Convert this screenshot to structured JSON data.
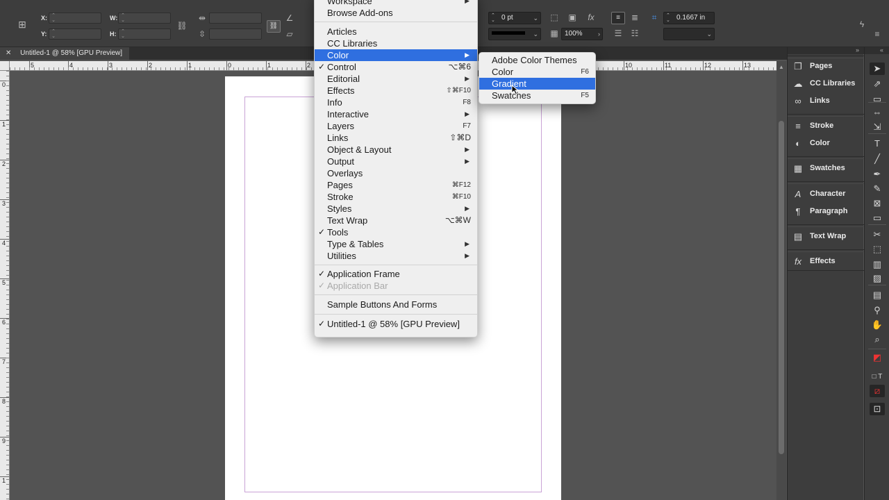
{
  "control_bar": {
    "x_label": "X:",
    "y_label": "Y:",
    "w_label": "W:",
    "h_label": "H:",
    "stroke_weight_value": "0 pt",
    "opacity_value": "100%",
    "offset_value": "0.1667 in"
  },
  "document_tab": {
    "close_glyph": "✕",
    "title": "Untitled-1 @ 58% [GPU Preview]"
  },
  "rulers": {
    "horizontal_labels": [
      "5",
      "4",
      "3",
      "2",
      "1",
      "0",
      "1",
      "2",
      "10",
      "11",
      "12",
      "13"
    ],
    "vertical_labels": [
      "0",
      "1",
      "2",
      "3",
      "4",
      "5",
      "6",
      "7",
      "8",
      "9",
      "1"
    ]
  },
  "window_menu": {
    "items": [
      {
        "label": "Workspace",
        "shortcut": "",
        "submenu": true,
        "checked": false,
        "highlighted": false,
        "disabled": false
      },
      {
        "label": "Browse Add-ons",
        "shortcut": "",
        "submenu": false,
        "checked": false,
        "highlighted": false,
        "disabled": false
      },
      {
        "label": "Articles",
        "shortcut": "",
        "submenu": false,
        "checked": false,
        "highlighted": false,
        "disabled": false
      },
      {
        "label": "CC Libraries",
        "shortcut": "",
        "submenu": false,
        "checked": false,
        "highlighted": false,
        "disabled": false
      },
      {
        "label": "Color",
        "shortcut": "",
        "submenu": true,
        "checked": false,
        "highlighted": true,
        "disabled": false
      },
      {
        "label": "Control",
        "shortcut": "⌥⌘6",
        "submenu": false,
        "checked": true,
        "highlighted": false,
        "disabled": false
      },
      {
        "label": "Editorial",
        "shortcut": "",
        "submenu": true,
        "checked": false,
        "highlighted": false,
        "disabled": false
      },
      {
        "label": "Effects",
        "shortcut": "⇧⌘F10",
        "submenu": false,
        "checked": false,
        "highlighted": false,
        "disabled": false
      },
      {
        "label": "Info",
        "shortcut": "F8",
        "submenu": false,
        "checked": false,
        "highlighted": false,
        "disabled": false
      },
      {
        "label": "Interactive",
        "shortcut": "",
        "submenu": true,
        "checked": false,
        "highlighted": false,
        "disabled": false
      },
      {
        "label": "Layers",
        "shortcut": "F7",
        "submenu": false,
        "checked": false,
        "highlighted": false,
        "disabled": false
      },
      {
        "label": "Links",
        "shortcut": "⇧⌘D",
        "submenu": false,
        "checked": false,
        "highlighted": false,
        "disabled": false
      },
      {
        "label": "Object & Layout",
        "shortcut": "",
        "submenu": true,
        "checked": false,
        "highlighted": false,
        "disabled": false
      },
      {
        "label": "Output",
        "shortcut": "",
        "submenu": true,
        "checked": false,
        "highlighted": false,
        "disabled": false
      },
      {
        "label": "Overlays",
        "shortcut": "",
        "submenu": false,
        "checked": false,
        "highlighted": false,
        "disabled": false
      },
      {
        "label": "Pages",
        "shortcut": "⌘F12",
        "submenu": false,
        "checked": false,
        "highlighted": false,
        "disabled": false
      },
      {
        "label": "Stroke",
        "shortcut": "⌘F10",
        "submenu": false,
        "checked": false,
        "highlighted": false,
        "disabled": false
      },
      {
        "label": "Styles",
        "shortcut": "",
        "submenu": true,
        "checked": false,
        "highlighted": false,
        "disabled": false
      },
      {
        "label": "Text Wrap",
        "shortcut": "⌥⌘W",
        "submenu": false,
        "checked": false,
        "highlighted": false,
        "disabled": false
      },
      {
        "label": "Tools",
        "shortcut": "",
        "submenu": false,
        "checked": true,
        "highlighted": false,
        "disabled": false
      },
      {
        "label": "Type & Tables",
        "shortcut": "",
        "submenu": true,
        "checked": false,
        "highlighted": false,
        "disabled": false
      },
      {
        "label": "Utilities",
        "shortcut": "",
        "submenu": true,
        "checked": false,
        "highlighted": false,
        "disabled": false
      },
      {
        "label": "Application Frame",
        "shortcut": "",
        "submenu": false,
        "checked": true,
        "highlighted": false,
        "disabled": false
      },
      {
        "label": "Application Bar",
        "shortcut": "",
        "submenu": false,
        "checked": true,
        "highlighted": false,
        "disabled": true
      },
      {
        "label": "Sample Buttons And Forms",
        "shortcut": "",
        "submenu": false,
        "checked": false,
        "highlighted": false,
        "disabled": false
      },
      {
        "label": "Untitled-1 @ 58% [GPU Preview]",
        "shortcut": "",
        "submenu": false,
        "checked": true,
        "highlighted": false,
        "disabled": false
      }
    ]
  },
  "color_submenu": {
    "items": [
      {
        "label": "Adobe Color Themes",
        "shortcut": "",
        "highlighted": false
      },
      {
        "label": "Color",
        "shortcut": "F6",
        "highlighted": false
      },
      {
        "label": "Gradient",
        "shortcut": "",
        "highlighted": true
      },
      {
        "label": "Swatches",
        "shortcut": "F5",
        "highlighted": false
      }
    ]
  },
  "panels_dock": {
    "items": [
      {
        "label": "Pages",
        "icon": "pages-icon"
      },
      {
        "label": "CC Libraries",
        "icon": "cc-libraries-icon"
      },
      {
        "label": "Links",
        "icon": "links-icon"
      },
      {
        "label": "Stroke",
        "icon": "stroke-icon"
      },
      {
        "label": "Color",
        "icon": "color-icon"
      },
      {
        "label": "Swatches",
        "icon": "swatches-icon"
      },
      {
        "label": "Character",
        "icon": "character-icon"
      },
      {
        "label": "Paragraph",
        "icon": "paragraph-icon"
      },
      {
        "label": "Text Wrap",
        "icon": "text-wrap-icon"
      },
      {
        "label": "Effects",
        "icon": "effects-icon"
      }
    ]
  },
  "tools": [
    "selection-tool",
    "direct-selection-tool",
    "page-tool",
    "gap-tool",
    "content-collector-tool",
    "type-tool",
    "line-tool",
    "pen-tool",
    "pencil-tool",
    "rectangle-frame-tool",
    "rectangle-tool",
    "scissors-tool",
    "free-transform-tool",
    "gradient-swatch-tool",
    "gradient-feather-tool",
    "note-tool",
    "eyedropper-tool",
    "hand-tool",
    "zoom-tool"
  ],
  "colors": {
    "menu_highlight": "#2f6fe0",
    "menu_background": "#efefef",
    "ui_dark": "#3d3d3d",
    "pasteboard": "#535353",
    "margin_guide": "#c9a2d6"
  }
}
